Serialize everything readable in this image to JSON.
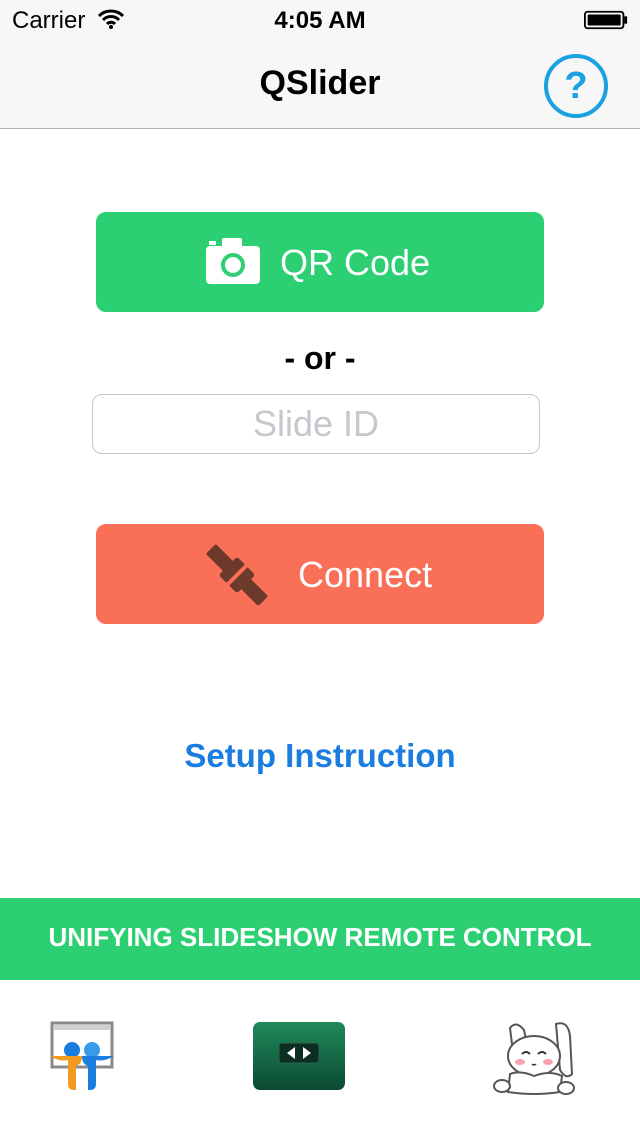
{
  "status_bar": {
    "carrier": "Carrier",
    "time": "4:05 AM",
    "wifi_icon": "wifi-icon",
    "battery_icon": "battery-icon"
  },
  "nav": {
    "title": "QSlider",
    "help_label": "?",
    "help_icon": "question-circle-icon"
  },
  "main": {
    "qr_button_label": "QR Code",
    "qr_icon": "camera-icon",
    "separator": "- or -",
    "slide_id_placeholder": "Slide ID",
    "slide_id_value": "",
    "connect_button_label": "Connect",
    "connect_icon": "plug-icon",
    "setup_link": "Setup Instruction"
  },
  "banner": {
    "text": "UNIFYING SLIDESHOW REMOTE CONTROL"
  },
  "bottom_apps": [
    {
      "icon": "slideshare-icon"
    },
    {
      "icon": "slide-remote-app-icon"
    },
    {
      "icon": "bunny-mascot-icon"
    }
  ],
  "colors": {
    "accent_green": "#2cd073",
    "connect_red": "#fa6f57",
    "link_blue": "#1a7de0",
    "help_blue": "#1aa1e0",
    "plug_brown": "#6b3a2a"
  }
}
